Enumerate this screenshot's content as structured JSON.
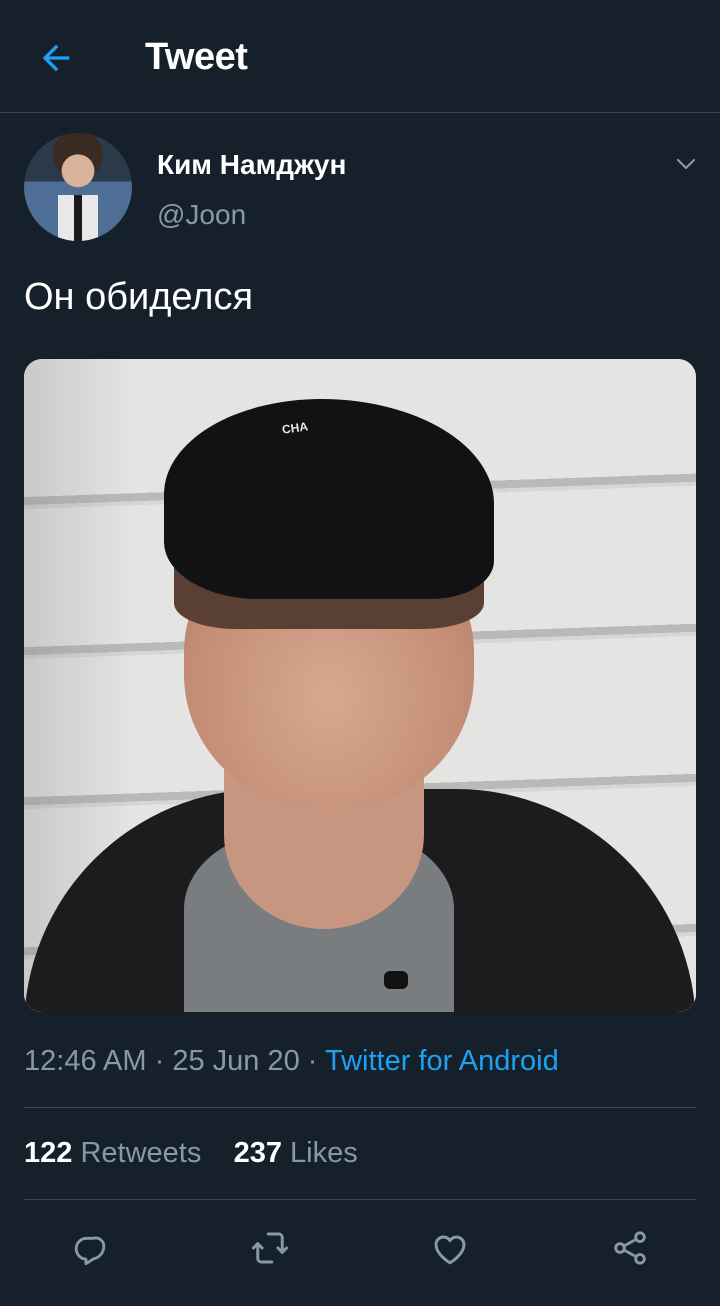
{
  "header": {
    "title": "Tweet",
    "back_icon": "arrow-left-icon",
    "accent": "#1da1f2"
  },
  "author": {
    "display_name": "Ким Намджун",
    "handle": "@Joon",
    "menu_icon": "chevron-down-icon"
  },
  "tweet": {
    "text": "Он обиделся"
  },
  "meta": {
    "time": "12:46 AM",
    "separator": "·",
    "date": "25 Jun 20",
    "source": "Twitter for Android"
  },
  "stats": {
    "retweets_count": "122",
    "retweets_label": "Retweets",
    "likes_count": "237",
    "likes_label": "Likes"
  },
  "media": {
    "cap_text": "CHA"
  },
  "actions": [
    {
      "icon": "reply-icon"
    },
    {
      "icon": "retweet-icon"
    },
    {
      "icon": "heart-icon"
    },
    {
      "icon": "share-icon"
    }
  ],
  "colors": {
    "background": "#15202b",
    "divider": "#38444d",
    "secondary_text": "#8899a6",
    "link": "#1da1f2"
  }
}
